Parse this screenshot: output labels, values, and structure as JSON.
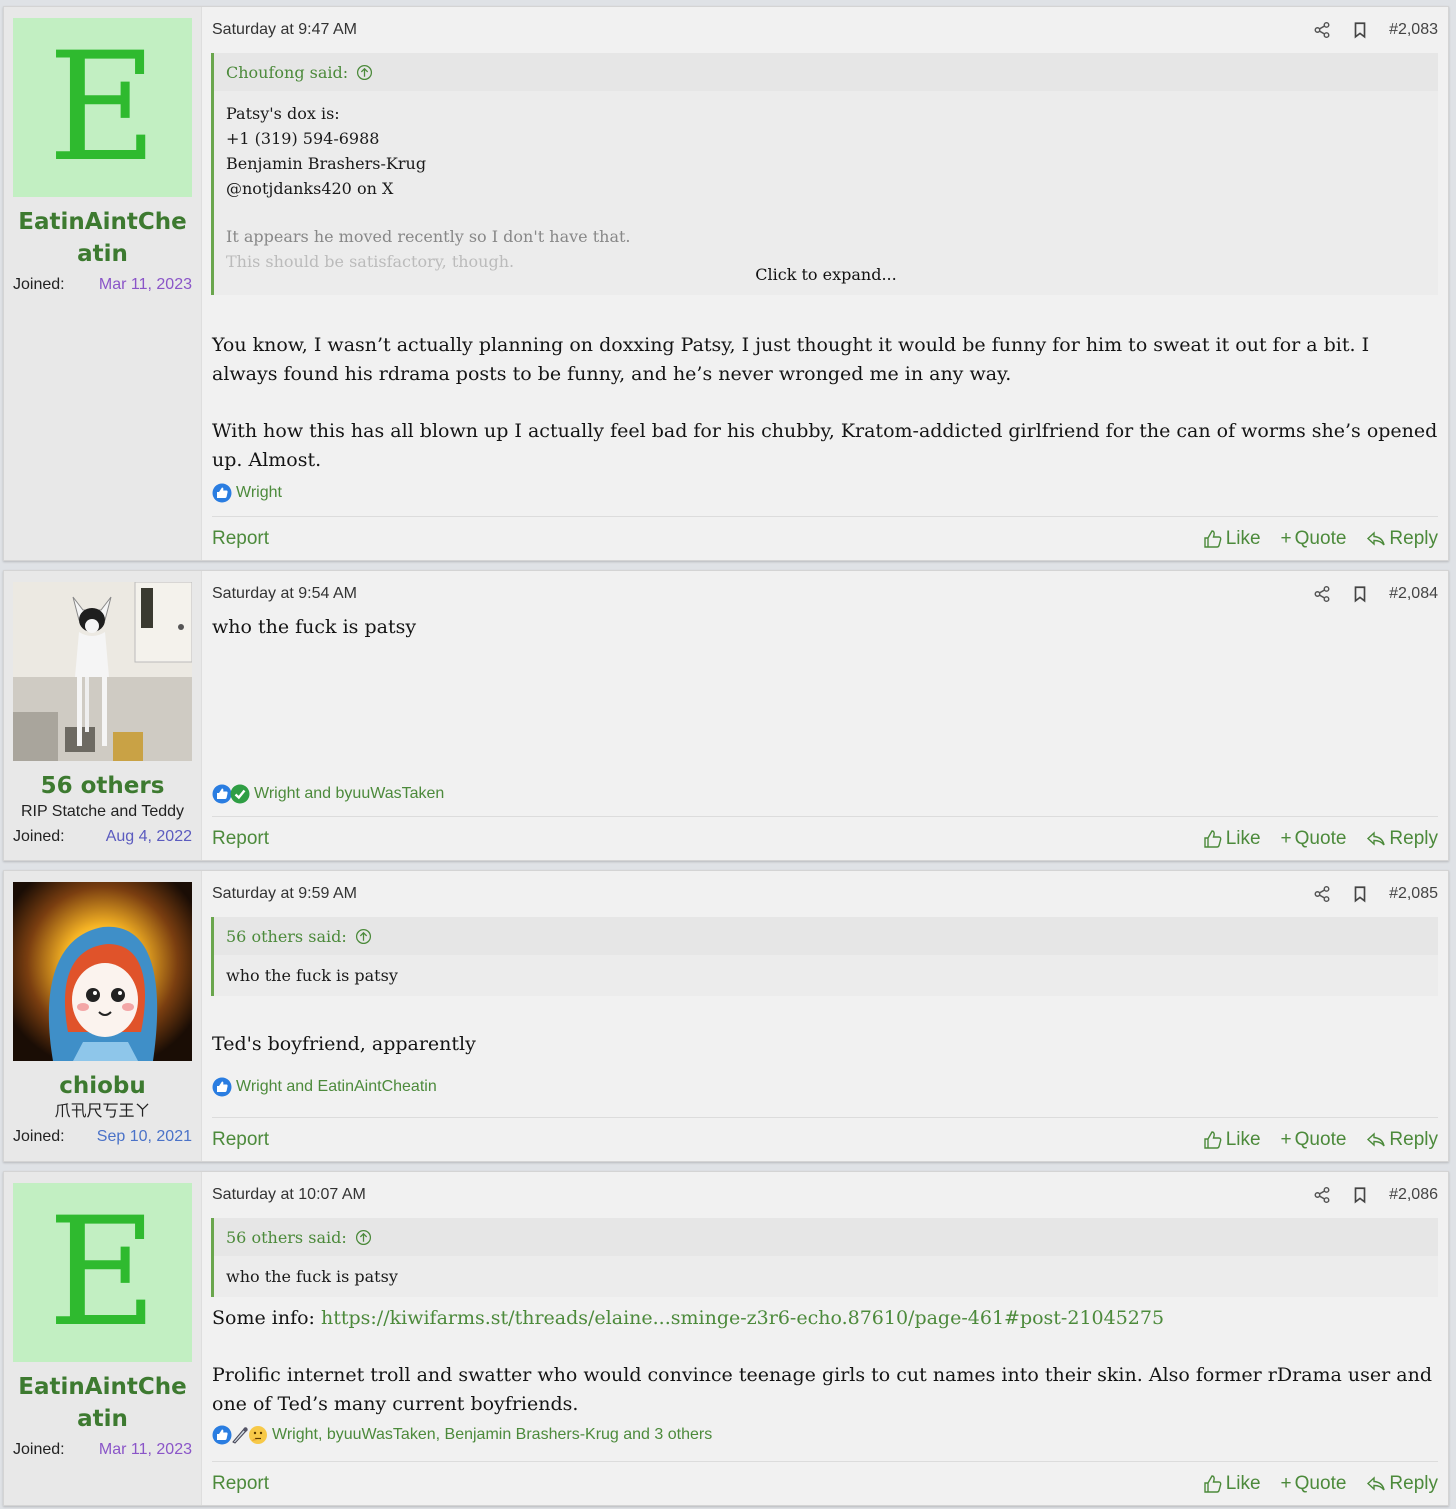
{
  "posts": [
    {
      "username": "EatinAintCheatin",
      "avatar_letter": "E",
      "joined_label": "Joined:",
      "joined_date": "Mar 11, 2023",
      "timestamp": "Saturday at 9:47 AM",
      "post_number": "#2,083",
      "quote": {
        "author": "Choufong said:",
        "lines": [
          "Patsy's dox is:",
          "+1 (319) 594-6988",
          "Benjamin Brashers-Krug",
          "@notjdanks420 on X",
          "",
          "It appears he moved recently so I don't have that.",
          "This should be satisfactory, though."
        ],
        "expand": "Click to expand..."
      },
      "message": [
        "You know, I wasn’t actually planning on doxxing Patsy, I just thought it would be funny for him to sweat it out for a bit. I always found his rdrama posts to be funny, and he’s never wronged me in any way.",
        "With how this has all blown up I actually feel bad for his chubby, Kratom-addicted girlfriend for the can of worms she’s opened up. Almost."
      ],
      "reactions": "Wright",
      "report": "Report",
      "like": "Like",
      "quote_btn": "Quote",
      "reply": "Reply"
    },
    {
      "username": "56 others",
      "user_title": "RIP Statche and Teddy",
      "joined_label": "Joined:",
      "joined_date": "Aug 4, 2022",
      "timestamp": "Saturday at 9:54 AM",
      "post_number": "#2,084",
      "message": [
        "who the fuck is patsy"
      ],
      "reactions": "Wright and byuuWasTaken",
      "report": "Report",
      "like": "Like",
      "quote_btn": "Quote",
      "reply": "Reply"
    },
    {
      "username": "chiobu",
      "user_title": "爪卂尺丂王ㄚ",
      "joined_label": "Joined:",
      "joined_date": "Sep 10, 2021",
      "timestamp": "Saturday at 9:59 AM",
      "post_number": "#2,085",
      "quote": {
        "author": "56 others said:",
        "lines": [
          "who the fuck is patsy"
        ]
      },
      "message": [
        "Ted's boyfriend, apparently"
      ],
      "reactions": "Wright and EatinAintCheatin",
      "report": "Report",
      "like": "Like",
      "quote_btn": "Quote",
      "reply": "Reply"
    },
    {
      "username": "EatinAintCheatin",
      "avatar_letter": "E",
      "joined_label": "Joined:",
      "joined_date": "Mar 11, 2023",
      "timestamp": "Saturday at 10:07 AM",
      "post_number": "#2,086",
      "quote": {
        "author": "56 others said:",
        "lines": [
          "who the fuck is patsy"
        ]
      },
      "message_prefix": "Some info: ",
      "message_link": "https://kiwifarms.st/threads/elaine...sminge-z3r6-echo.87610/page-461#post-21045275",
      "message": [
        "Prolific internet troll and swatter who would convince teenage girls to cut names into their skin. Also former rDrama user and one of Ted’s many current boyfriends."
      ],
      "reactions": "Wright, byuuWasTaken, Benjamin Brashers-Krug and 3 others",
      "report": "Report",
      "like": "Like",
      "quote_btn": "Quote",
      "reply": "Reply"
    }
  ],
  "icons": {
    "share": "share-icon",
    "bookmark": "bookmark-icon",
    "like": "thumbs-up-icon",
    "quote": "plus-icon",
    "reply": "reply-icon",
    "quote_up": "arrow-up-circle-icon"
  },
  "colors": {
    "link_green": "#4c8a3b",
    "avatar_bg": "#c2efc2",
    "avatar_letter": "#2fba2f",
    "joined_date": "#8a55c8"
  }
}
